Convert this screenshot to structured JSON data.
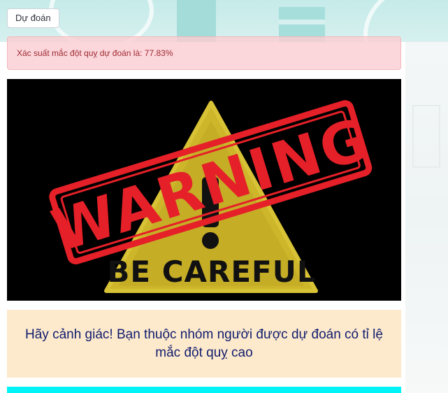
{
  "predict_button": {
    "label": "Dự đoán"
  },
  "alert": {
    "message": "Xác suất mắc đột quỵ dự đoán là: 77.83%",
    "probability_percent": 77.83
  },
  "warning_image": {
    "stamp_text": "WARNING",
    "subtitle": "BE CAREFUL",
    "icon": "warning-triangle-icon"
  },
  "notice": {
    "text": "Hãy cảnh giác! Bạn thuộc nhóm người được dự đoán có tỉ lệ mắc đột quỵ cao"
  },
  "colors": {
    "alert_bg": "#fbd2d6",
    "alert_text": "#9e2a33",
    "notice_bg": "#fde9cc",
    "notice_text": "#101d6e",
    "stamp_red": "#e52028",
    "triangle_yellow": "#cdb62a",
    "accent_bar": "#00f3f6"
  }
}
